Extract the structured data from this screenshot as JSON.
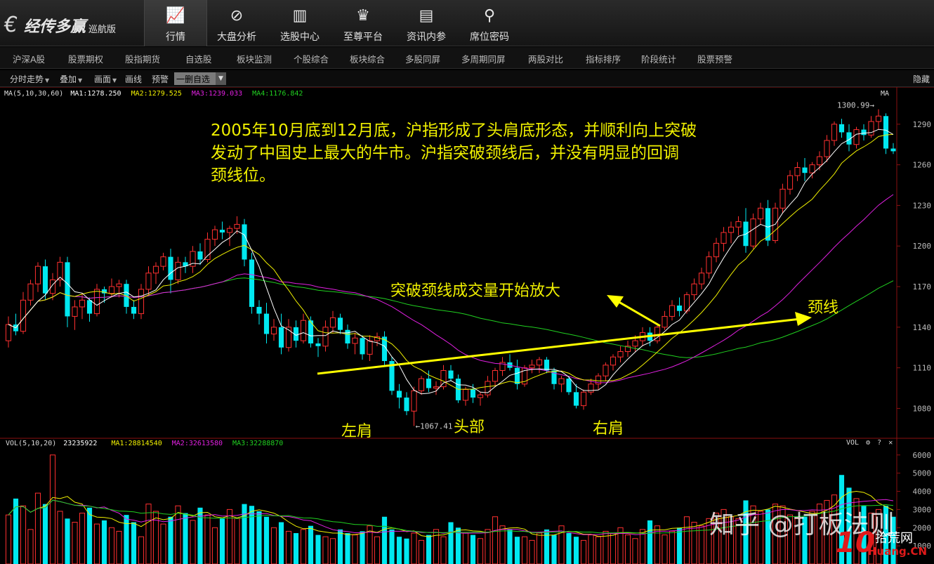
{
  "app": {
    "logo_text": "经传多赢",
    "edition": "巡航版"
  },
  "nav": [
    {
      "label": "行情",
      "icon": "trend-chart-icon",
      "glyph": "📈"
    },
    {
      "label": "大盘分析",
      "icon": "no-sign-icon",
      "glyph": "⊘"
    },
    {
      "label": "选股中心",
      "icon": "bar-chart-icon",
      "glyph": "▥"
    },
    {
      "label": "至尊平台",
      "icon": "crown-icon",
      "glyph": "♛"
    },
    {
      "label": "资讯内参",
      "icon": "printer-icon",
      "glyph": "▤"
    },
    {
      "label": "席位密码",
      "icon": "key-icon",
      "glyph": "⚲"
    }
  ],
  "menu2": [
    "沪深A股",
    "股票期权",
    "股指期货",
    "自选股",
    "板块监测",
    "个股综合",
    "板块综合",
    "多股同屏",
    "多周期同屏",
    "两股对比",
    "指标排序",
    "阶段统计",
    "股票预警"
  ],
  "toolbar": {
    "items": [
      "分时走势",
      "叠加",
      "画面",
      "画线",
      "预警"
    ],
    "dropdown_items": [
      true,
      true,
      true,
      false,
      false
    ],
    "select_value": "一删自选",
    "hide_label": "隐藏"
  },
  "price_panel": {
    "legend": {
      "label": "MA(5,10,30,60)",
      "ma1": "MA1:1278.250",
      "ma2": "MA2:1279.525",
      "ma3": "MA3:1239.033",
      "ma4": "MA4:1176.842"
    },
    "right_label": "MA",
    "colors": {
      "ma1": "#ffffff",
      "ma2": "#f0f000",
      "ma3": "#e020e0",
      "ma4": "#20d020",
      "up": "#ff3030",
      "down": "#00e8f0",
      "axis": "#bbbbbb"
    },
    "y_ticks": [
      "1290",
      "1260",
      "1230",
      "1200",
      "1170",
      "1140",
      "1110",
      "1080"
    ],
    "high_label": "1300.99",
    "low_label": "1067.41"
  },
  "annotations": {
    "main_text_lines": [
      "2005年10月底到12月底，沪指形成了头肩底形态，并顺利向上突破",
      "发动了中国史上最大的牛市。沪指突破颈线后，并没有明显的回调",
      "颈线位。"
    ],
    "volume_note": "突破颈线成交量开始放大",
    "neckline": "颈线",
    "left_shoulder": "左肩",
    "head": "头部",
    "right_shoulder": "右肩"
  },
  "volume_panel": {
    "legend": {
      "label": "VOL(5,10,20)",
      "value": "23235922",
      "ma1": "MA1:28814540",
      "ma2": "MA2:32613580",
      "ma3": "MA3:32288870"
    },
    "right_label": "VOL",
    "y_ticks": [
      "6000",
      "5000",
      "4000",
      "3000",
      "2000",
      "1000"
    ]
  },
  "watermark": "知乎 @打板法则",
  "badge": {
    "number": "10",
    "cn": "拾荒网",
    "en": "Huang.CN"
  },
  "chart_data": {
    "type": "candlestick",
    "ohlc": [
      [
        1130,
        1148,
        1125,
        1142
      ],
      [
        1142,
        1150,
        1134,
        1137
      ],
      [
        1137,
        1166,
        1135,
        1160
      ],
      [
        1160,
        1175,
        1156,
        1172
      ],
      [
        1172,
        1188,
        1166,
        1185
      ],
      [
        1185,
        1190,
        1160,
        1165
      ],
      [
        1165,
        1180,
        1160,
        1175
      ],
      [
        1175,
        1192,
        1170,
        1188
      ],
      [
        1188,
        1192,
        1140,
        1148
      ],
      [
        1148,
        1160,
        1138,
        1155
      ],
      [
        1155,
        1165,
        1146,
        1160
      ],
      [
        1160,
        1162,
        1144,
        1150
      ],
      [
        1150,
        1172,
        1148,
        1168
      ],
      [
        1168,
        1170,
        1158,
        1165
      ],
      [
        1165,
        1176,
        1162,
        1170
      ],
      [
        1170,
        1175,
        1162,
        1172
      ],
      [
        1172,
        1175,
        1150,
        1155
      ],
      [
        1155,
        1160,
        1146,
        1150
      ],
      [
        1150,
        1172,
        1146,
        1168
      ],
      [
        1168,
        1185,
        1164,
        1180
      ],
      [
        1180,
        1188,
        1172,
        1185
      ],
      [
        1185,
        1195,
        1182,
        1192
      ],
      [
        1192,
        1198,
        1165,
        1175
      ],
      [
        1175,
        1192,
        1172,
        1188
      ],
      [
        1188,
        1192,
        1180,
        1185
      ],
      [
        1185,
        1200,
        1180,
        1196
      ],
      [
        1196,
        1202,
        1186,
        1190
      ],
      [
        1190,
        1210,
        1188,
        1205
      ],
      [
        1205,
        1215,
        1200,
        1212
      ],
      [
        1212,
        1218,
        1205,
        1210
      ],
      [
        1210,
        1215,
        1200,
        1213
      ],
      [
        1213,
        1222,
        1209,
        1216
      ],
      [
        1216,
        1220,
        1185,
        1190
      ],
      [
        1190,
        1195,
        1150,
        1155
      ],
      [
        1155,
        1160,
        1142,
        1150
      ],
      [
        1150,
        1158,
        1128,
        1135
      ],
      [
        1135,
        1146,
        1130,
        1140
      ],
      [
        1140,
        1150,
        1120,
        1125
      ],
      [
        1125,
        1146,
        1122,
        1140
      ],
      [
        1140,
        1145,
        1125,
        1130
      ],
      [
        1130,
        1150,
        1128,
        1145
      ],
      [
        1145,
        1148,
        1125,
        1128
      ],
      [
        1128,
        1132,
        1118,
        1126
      ],
      [
        1126,
        1145,
        1122,
        1140
      ],
      [
        1140,
        1152,
        1136,
        1147
      ],
      [
        1147,
        1150,
        1135,
        1138
      ],
      [
        1138,
        1142,
        1124,
        1128
      ],
      [
        1128,
        1136,
        1120,
        1132
      ],
      [
        1132,
        1134,
        1116,
        1120
      ],
      [
        1120,
        1134,
        1115,
        1130
      ],
      [
        1130,
        1136,
        1126,
        1133
      ],
      [
        1133,
        1137,
        1112,
        1115
      ],
      [
        1115,
        1118,
        1090,
        1093
      ],
      [
        1093,
        1098,
        1080,
        1088
      ],
      [
        1088,
        1092,
        1075,
        1078
      ],
      [
        1078,
        1096,
        1067,
        1093
      ],
      [
        1093,
        1104,
        1090,
        1102
      ],
      [
        1102,
        1108,
        1092,
        1095
      ],
      [
        1095,
        1100,
        1090,
        1096
      ],
      [
        1096,
        1112,
        1094,
        1108
      ],
      [
        1108,
        1112,
        1100,
        1102
      ],
      [
        1102,
        1105,
        1084,
        1086
      ],
      [
        1086,
        1096,
        1082,
        1094
      ],
      [
        1094,
        1098,
        1084,
        1088
      ],
      [
        1088,
        1092,
        1082,
        1090
      ],
      [
        1090,
        1104,
        1088,
        1100
      ],
      [
        1100,
        1110,
        1096,
        1108
      ],
      [
        1108,
        1118,
        1104,
        1114
      ],
      [
        1114,
        1120,
        1108,
        1110
      ],
      [
        1110,
        1116,
        1094,
        1098
      ],
      [
        1098,
        1112,
        1096,
        1110
      ],
      [
        1110,
        1116,
        1106,
        1112
      ],
      [
        1112,
        1118,
        1106,
        1116
      ],
      [
        1116,
        1118,
        1106,
        1108
      ],
      [
        1108,
        1110,
        1094,
        1098
      ],
      [
        1098,
        1104,
        1092,
        1102
      ],
      [
        1102,
        1104,
        1090,
        1092
      ],
      [
        1092,
        1098,
        1080,
        1082
      ],
      [
        1082,
        1094,
        1079,
        1092
      ],
      [
        1092,
        1102,
        1090,
        1098
      ],
      [
        1098,
        1106,
        1094,
        1104
      ],
      [
        1104,
        1114,
        1100,
        1112
      ],
      [
        1112,
        1120,
        1108,
        1118
      ],
      [
        1118,
        1126,
        1114,
        1122
      ],
      [
        1122,
        1130,
        1118,
        1126
      ],
      [
        1126,
        1134,
        1122,
        1130
      ],
      [
        1130,
        1140,
        1126,
        1136
      ],
      [
        1136,
        1140,
        1126,
        1130
      ],
      [
        1130,
        1142,
        1128,
        1140
      ],
      [
        1140,
        1152,
        1138,
        1148
      ],
      [
        1148,
        1160,
        1145,
        1156
      ],
      [
        1156,
        1162,
        1148,
        1152
      ],
      [
        1152,
        1166,
        1150,
        1164
      ],
      [
        1164,
        1176,
        1160,
        1172
      ],
      [
        1172,
        1184,
        1168,
        1180
      ],
      [
        1180,
        1196,
        1176,
        1192
      ],
      [
        1192,
        1206,
        1188,
        1202
      ],
      [
        1202,
        1214,
        1196,
        1210
      ],
      [
        1210,
        1218,
        1202,
        1214
      ],
      [
        1214,
        1222,
        1208,
        1218
      ],
      [
        1218,
        1228,
        1195,
        1200
      ],
      [
        1200,
        1224,
        1198,
        1220
      ],
      [
        1220,
        1232,
        1216,
        1228
      ],
      [
        1228,
        1234,
        1200,
        1204
      ],
      [
        1204,
        1232,
        1202,
        1228
      ],
      [
        1228,
        1246,
        1224,
        1242
      ],
      [
        1242,
        1256,
        1238,
        1252
      ],
      [
        1252,
        1262,
        1248,
        1258
      ],
      [
        1258,
        1265,
        1248,
        1254
      ],
      [
        1254,
        1262,
        1250,
        1260
      ],
      [
        1260,
        1270,
        1256,
        1266
      ],
      [
        1266,
        1282,
        1262,
        1278
      ],
      [
        1278,
        1292,
        1274,
        1290
      ],
      [
        1290,
        1294,
        1280,
        1284
      ],
      [
        1284,
        1290,
        1270,
        1275
      ],
      [
        1275,
        1288,
        1272,
        1286
      ],
      [
        1286,
        1290,
        1278,
        1282
      ],
      [
        1282,
        1296,
        1280,
        1292
      ],
      [
        1292,
        1301,
        1286,
        1296
      ],
      [
        1296,
        1298,
        1268,
        1272
      ],
      [
        1272,
        1276,
        1268,
        1270
      ]
    ],
    "volume": [
      2700,
      3600,
      3200,
      1900,
      3900,
      3300,
      6000,
      2900,
      2500,
      2300,
      2800,
      3100,
      2200,
      2400,
      2000,
      1800,
      2700,
      2300,
      1500,
      3300,
      2900,
      2200,
      2600,
      3200,
      2800,
      2400,
      3100,
      2700,
      2000,
      2500,
      3000,
      2500,
      3300,
      3200,
      2900,
      2600,
      2000,
      2300,
      1800,
      1700,
      1900,
      2100,
      1600,
      1500,
      1400,
      1900,
      1700,
      1600,
      1800,
      2100,
      1500,
      2600,
      1900,
      1500,
      1400,
      1700,
      1300,
      1600,
      1900,
      1500,
      2300,
      2000,
      1700,
      1600,
      1400,
      1900,
      2600,
      2100,
      1900,
      1500,
      1500,
      1300,
      1700,
      1900,
      1600,
      2100,
      1700,
      1500,
      1300,
      1600,
      1500,
      1800,
      1700,
      2000,
      1600,
      1400,
      1900,
      2400,
      2100,
      1600,
      1800,
      2000,
      2600,
      2300,
      2100,
      2500,
      2800,
      3000,
      2600,
      2500,
      3500,
      3200,
      2900,
      3000,
      3300,
      3200,
      2700,
      2500,
      2600,
      2900,
      3300,
      3500,
      3800,
      4900,
      4200,
      3600,
      3200,
      2800,
      3000,
      3200,
      2600
    ],
    "y_range": [
      1060,
      1306
    ],
    "vol_range": [
      0,
      6300
    ]
  }
}
